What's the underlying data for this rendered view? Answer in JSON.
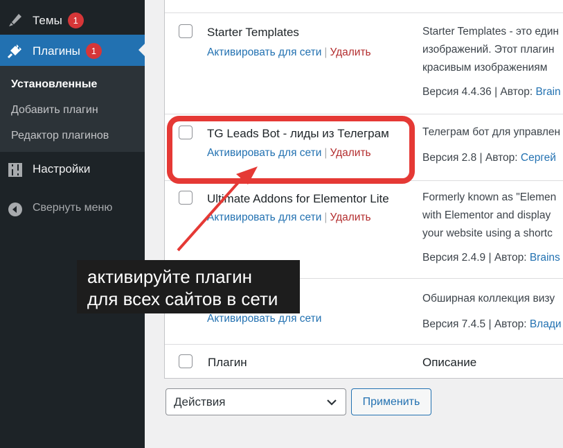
{
  "sidebar": {
    "themes": {
      "label": "Темы",
      "badge": "1",
      "icon": "paintbrush-icon"
    },
    "plugins": {
      "label": "Плагины",
      "badge": "1",
      "icon": "plugin-icon"
    },
    "submenu": {
      "installed": "Установленные",
      "add": "Добавить плагин",
      "editor": "Редактор плагинов"
    },
    "settings": {
      "label": "Настройки",
      "icon": "settings-sliders-icon"
    },
    "collapse": {
      "label": "Свернуть меню",
      "icon": "collapse-arrow-icon"
    }
  },
  "plugins": [
    {
      "title": "Starter Templates",
      "activate": "Активировать для сети",
      "delete": "Удалить",
      "desc": [
        "Starter Templates - это един",
        "изображений. Этот плагин",
        "красивым изображениям"
      ],
      "version": "Версия 4.4.36",
      "author_label": "Автор:",
      "author": "Brain"
    },
    {
      "title": "TG Leads Bot - лиды из Телеграм",
      "activate": "Активировать для сети",
      "delete": "Удалить",
      "desc": [
        "Телеграм бот для управлен"
      ],
      "version": "Версия 2.8",
      "author_label": "Автор:",
      "author": "Сергей"
    },
    {
      "title": "Ultimate Addons for Elementor Lite",
      "activate": "Активировать для сети",
      "delete": "Удалить",
      "desc": [
        "Formerly known as \"Elemen",
        "with Elementor and display",
        "your website using a shortc"
      ],
      "version": "Версия 2.4.9",
      "author_label": "Автор:",
      "author": "Brains"
    },
    {
      "title": "",
      "activate": "Активировать для сети",
      "desc": [
        "Обширная коллекция визу"
      ],
      "version": "Версия 7.4.5",
      "author_label": "Автор:",
      "author": "Влади"
    }
  ],
  "footer": {
    "col_plugin": "Плагин",
    "col_desc": "Описание"
  },
  "bulk": {
    "selected": "Действия",
    "apply": "Применить"
  },
  "annotation": {
    "line1": "активируйте плагин",
    "line2": "для всех сайтов в сети",
    "color": "#e53935"
  },
  "colors": {
    "sidebar": "#1d2327",
    "accent": "#2271b1",
    "badge": "#d63638",
    "delete": "#b32d2e"
  }
}
